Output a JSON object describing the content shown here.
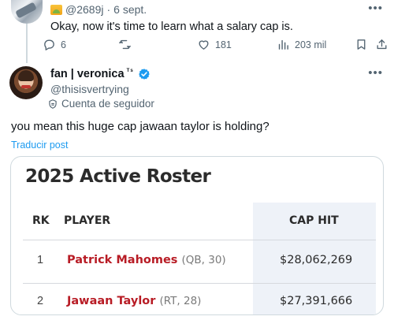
{
  "parent_tweet": {
    "handle": "@2689j",
    "separator": "·",
    "date": "6 sept.",
    "text": "Okay, now it's time to learn what a salary cap is.",
    "stats": {
      "replies": "6",
      "retweets": "",
      "likes": "181",
      "views": "203 mil"
    },
    "icons": [
      "image-emoji-icon",
      "reply-icon",
      "retweet-icon",
      "like-icon",
      "views-icon",
      "bookmark-icon",
      "share-icon",
      "more-icon"
    ]
  },
  "reply_tweet": {
    "display_name": "fan | veronica",
    "name_suffix": "ᵀˢ",
    "handle": "@thisisvertrying",
    "follower_label": "Cuenta de seguidor",
    "text": "you mean this huge cap jawaan taylor is holding?",
    "translate_label": "Traducir post"
  },
  "roster_image": {
    "title": "2025 Active Roster",
    "columns": [
      "RK",
      "PLAYER",
      "CAP HIT"
    ],
    "rows": [
      {
        "rk": "1",
        "name": "Patrick Mahomes",
        "pos": "(QB, 30)",
        "cap": "$28,062,269"
      },
      {
        "rk": "2",
        "name": "Jawaan Taylor",
        "pos": "(RT, 28)",
        "cap": "$27,391,666"
      }
    ]
  },
  "colors": {
    "link_blue": "#1d9bf0",
    "verified_blue": "#1d9bf0",
    "player_red": "#b81c25",
    "muted_text": "#536471",
    "cap_column_bg": "#eef2f8"
  }
}
